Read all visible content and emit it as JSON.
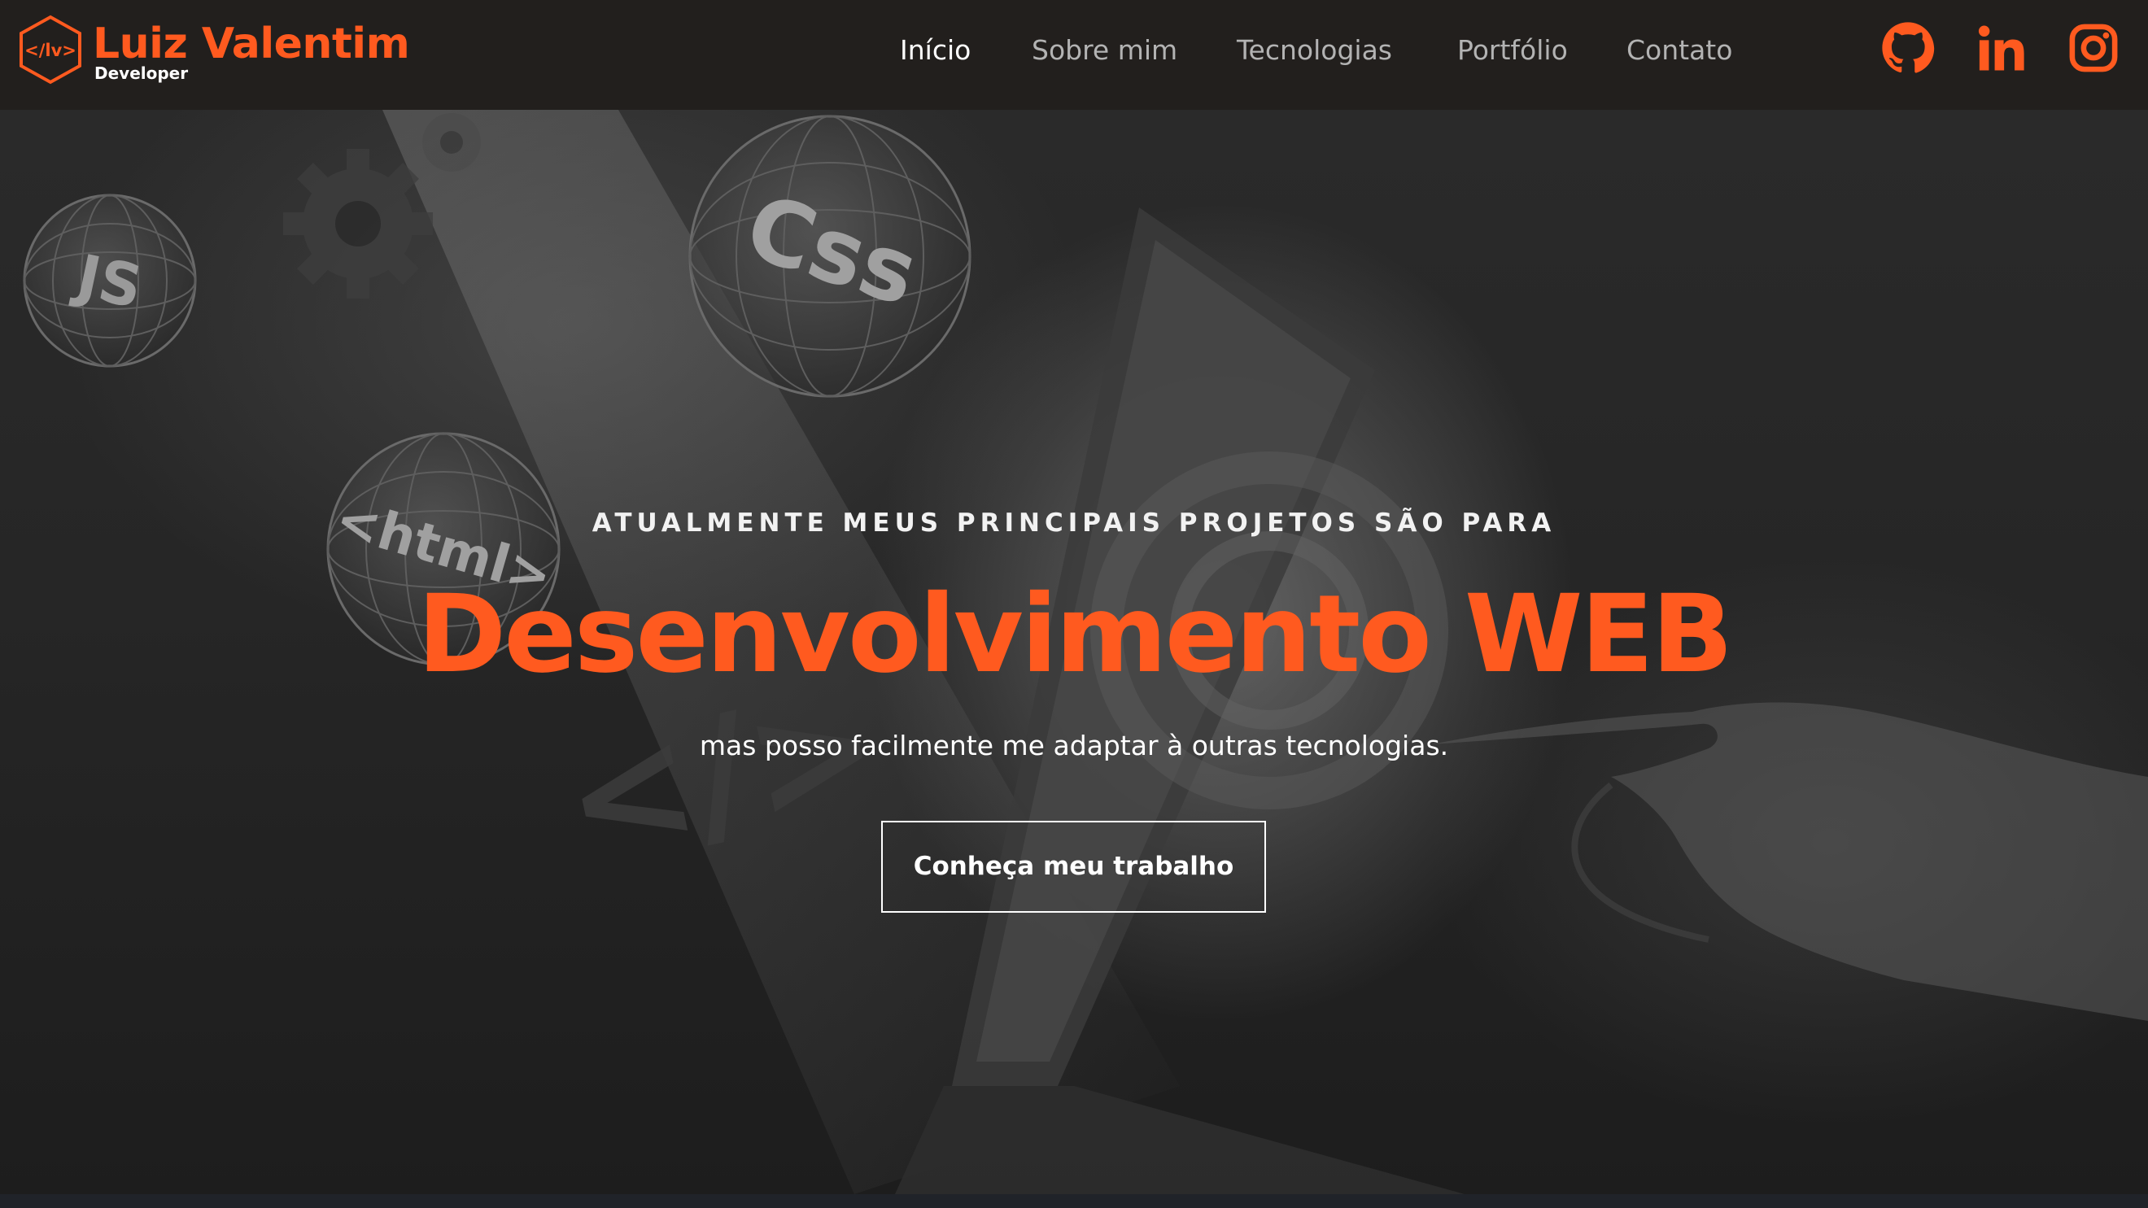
{
  "header": {
    "logo": {
      "mark": "</lv>",
      "name": "Luiz Valentim",
      "subtitle": "Developer",
      "icon": "code-hexagon-icon"
    },
    "nav": [
      {
        "label": "Início",
        "active": true
      },
      {
        "label": "Sobre mim",
        "active": false
      },
      {
        "label": "Tecnologias",
        "active": false
      },
      {
        "label": "Portfólio",
        "active": false
      },
      {
        "label": "Contato",
        "active": false
      }
    ],
    "socials": [
      {
        "icon": "github-icon"
      },
      {
        "icon": "linkedin-icon"
      },
      {
        "icon": "instagram-icon"
      }
    ]
  },
  "hero": {
    "kicker": "ATUALMENTE MEUS PRINCIPAIS PROJETOS SÃO PARA",
    "title": "Desenvolvimento WEB",
    "subtitle": "mas posso facilmente me adaptar à outras tecnologias.",
    "cta_label": "Conheça meu trabalho",
    "background_labels": [
      "JS",
      "Css",
      "<html>",
      "</>"
    ]
  },
  "colors": {
    "accent": "#ff5a1f",
    "header_bg": "#221f1d",
    "nav_text": "#b3b3b3",
    "nav_active": "#ffffff"
  }
}
